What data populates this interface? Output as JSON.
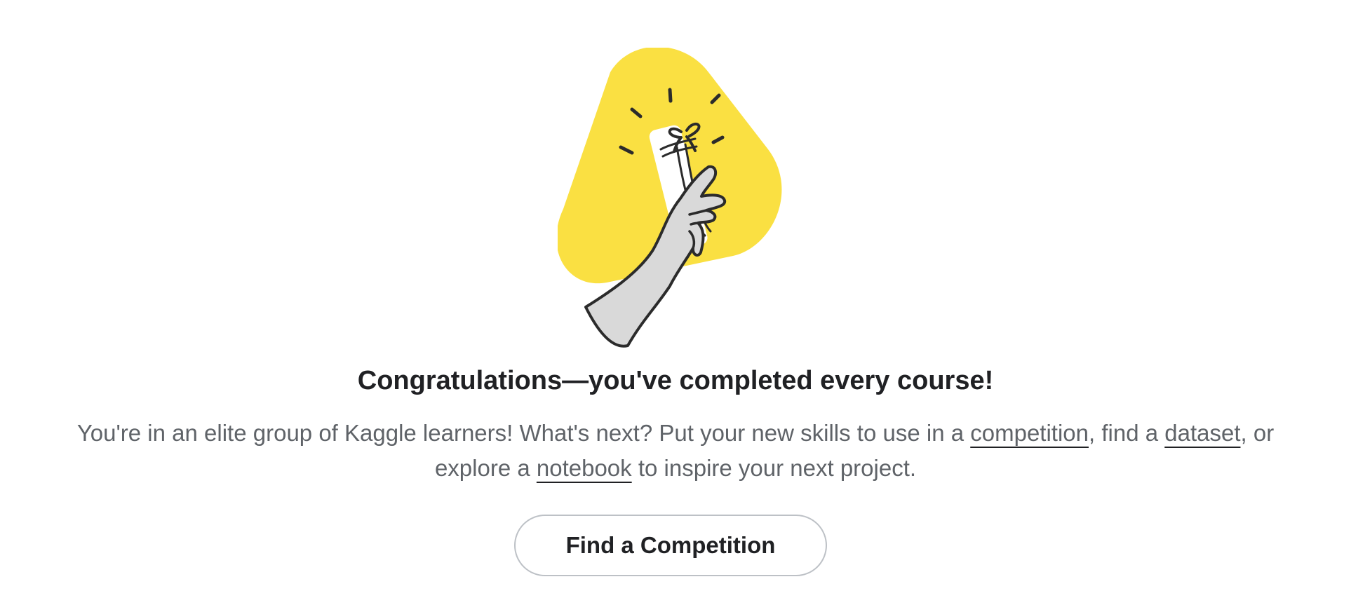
{
  "illustration": {
    "icon": "hand-holding-certificate-icon",
    "accent_color": "#FAE042",
    "hand_color": "#D9D9D9"
  },
  "headline": "Congratulations—you've completed every course!",
  "body": {
    "part1": "You're in an elite group of Kaggle learners! What's next? Put your new skills to use in a ",
    "link_competition": "competition",
    "part2": ", find a ",
    "link_dataset": "dataset",
    "part3": ", or explore a ",
    "link_notebook": "notebook",
    "part4": " to inspire your next project."
  },
  "cta": {
    "label": "Find a Competition"
  },
  "colors": {
    "heading": "#202124",
    "body": "#5F6368",
    "button_border": "#BDC1C6"
  }
}
